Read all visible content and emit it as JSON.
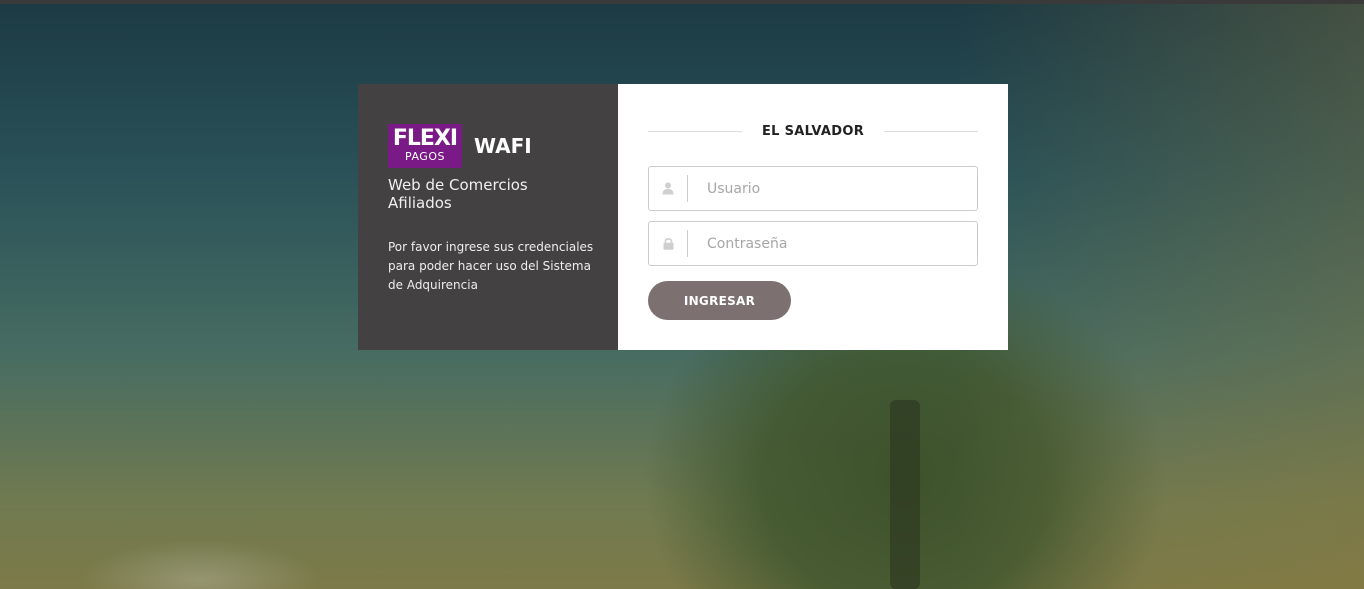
{
  "brand": {
    "logo_top": "FLEXI",
    "logo_bottom": "PAGOS",
    "app_name": "WAFI",
    "subtitle": "Web de Comercios Afiliados",
    "description": "Por favor ingrese sus credenciales para poder hacer uso del Sistema de Adquirencia"
  },
  "login": {
    "region": "EL SALVADOR",
    "username": {
      "placeholder": "Usuario",
      "value": "",
      "icon": "user-icon"
    },
    "password": {
      "placeholder": "Contraseña",
      "value": "",
      "icon": "lock-icon"
    },
    "submit_label": "INGRESAR"
  },
  "colors": {
    "left_panel": "#434141",
    "logo_bg": "#7a1a86",
    "button": "#7c7070",
    "panel_right": "#ffffff"
  }
}
